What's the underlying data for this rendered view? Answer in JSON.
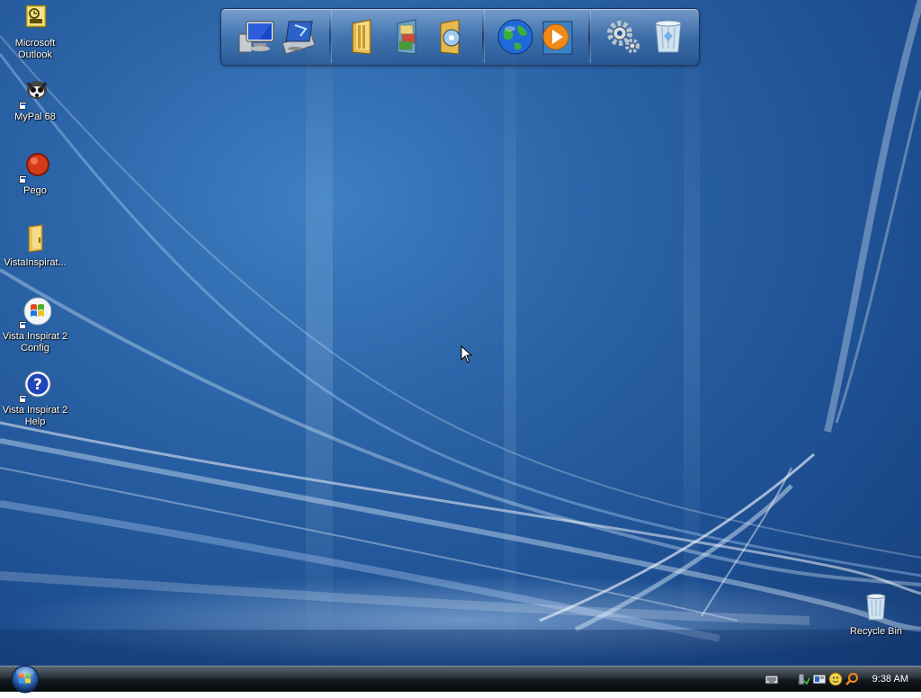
{
  "desktop_icons": [
    {
      "name": "Microsoft Outlook",
      "icon": "outlook-icon"
    },
    {
      "name": "MyPal 68",
      "icon": "mypal-icon"
    },
    {
      "name": "Pego",
      "icon": "pego-icon"
    },
    {
      "name": "VistaInspirat...",
      "icon": "folder-icon"
    },
    {
      "name": "Vista Inspirat 2 Config",
      "icon": "windows-logo-icon"
    },
    {
      "name": "Vista Inspirat 2 Help",
      "icon": "help-icon"
    },
    {
      "name": "Recycle Bin",
      "icon": "recycle-bin-icon"
    }
  ],
  "dock_items": [
    {
      "icon": "computer-icon"
    },
    {
      "icon": "drive-icon"
    },
    {
      "icon": "documents-folder-icon"
    },
    {
      "icon": "pictures-folder-icon"
    },
    {
      "icon": "music-folder-icon"
    },
    {
      "icon": "internet-globe-icon"
    },
    {
      "icon": "media-player-icon"
    },
    {
      "icon": "settings-gears-icon"
    },
    {
      "icon": "recycle-bin-icon"
    }
  ],
  "taskbar": {
    "clock": "9:38 AM"
  },
  "colors": {
    "desktop_bg": "#2a63a6",
    "taskbar_bg": "#12181c"
  }
}
